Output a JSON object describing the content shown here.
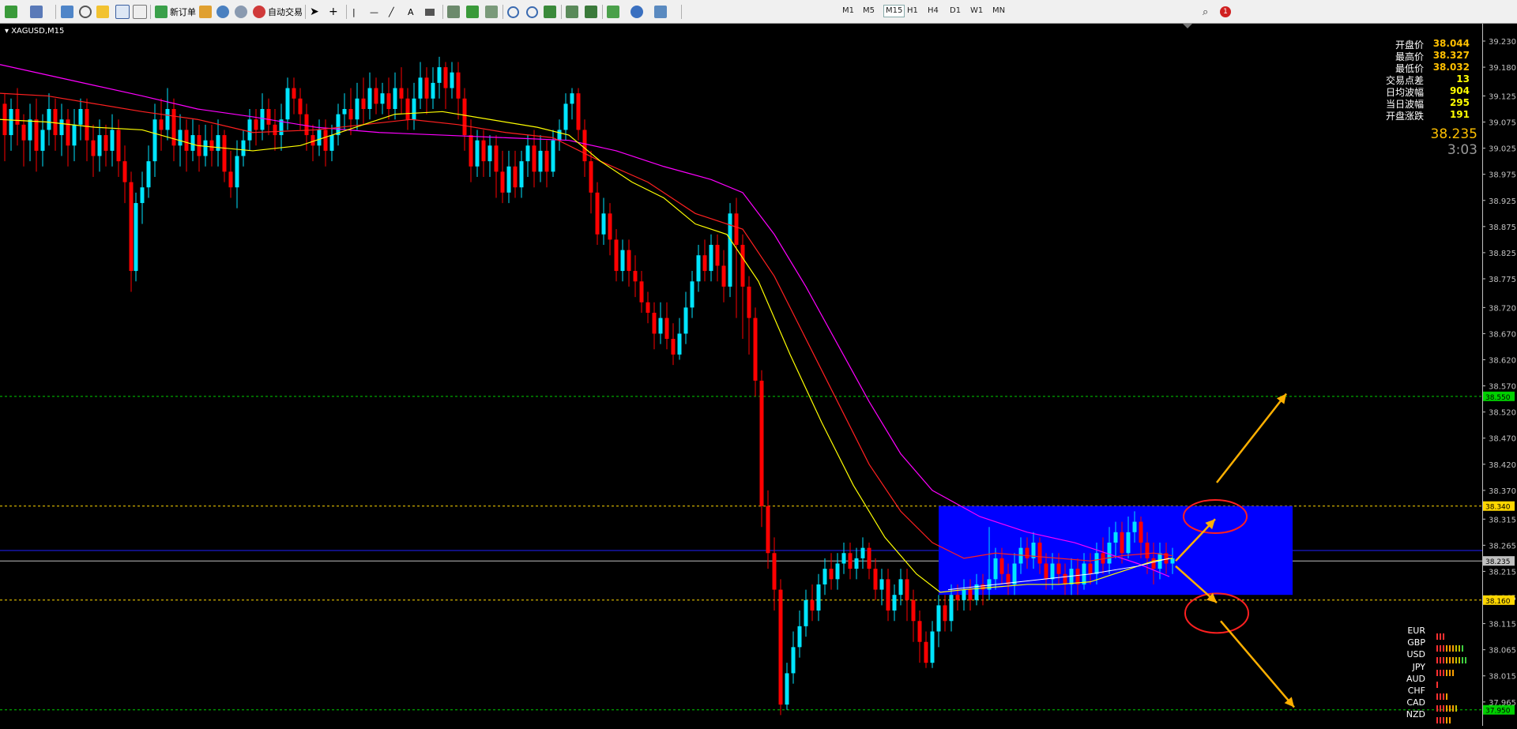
{
  "toolbar": {
    "new_order": "新订单",
    "auto_trade": "自动交易",
    "text_tool": "A",
    "timeframes": [
      "M1",
      "M5",
      "M15",
      "H1",
      "H4",
      "D1",
      "W1",
      "MN"
    ],
    "active_timeframe": "M15"
  },
  "symbol": "XAGUSD,M15",
  "info": [
    {
      "label": "开盘价",
      "value": "38.044",
      "color": "#ffc000"
    },
    {
      "label": "最高价",
      "value": "38.327",
      "color": "#ffc000"
    },
    {
      "label": "最低价",
      "value": "38.032",
      "color": "#ffc000"
    },
    {
      "label": "交易点差",
      "value": "13",
      "color": "#ffff00"
    },
    {
      "label": "日均波幅",
      "value": "904",
      "color": "#ffff00"
    },
    {
      "label": "当日波幅",
      "value": "295",
      "color": "#ffff00"
    },
    {
      "label": "开盘涨跌",
      "value": "191",
      "color": "#ffff00"
    }
  ],
  "bid_price": "38.235",
  "countdown": "3:03",
  "price_scale": [
    "39.230",
    "39.180",
    "39.125",
    "39.075",
    "39.025",
    "38.975",
    "38.925",
    "38.875",
    "38.825",
    "38.775",
    "38.720",
    "38.670",
    "38.620",
    "38.570",
    "38.520",
    "38.470",
    "38.420",
    "38.370",
    "38.315",
    "38.265",
    "38.215",
    "38.165",
    "38.115",
    "38.065",
    "38.015",
    "37.965"
  ],
  "price_tags": [
    {
      "price": "38.550",
      "color": "#00d000"
    },
    {
      "price": "38.340",
      "color": "#ffd700"
    },
    {
      "price": "38.235",
      "color": "#c0c0c0"
    },
    {
      "price": "38.160",
      "color": "#ffd700"
    },
    {
      "price": "37.950",
      "color": "#00d000"
    }
  ],
  "currencies": [
    {
      "code": "EUR",
      "strength": 3
    },
    {
      "code": "GBP",
      "strength": 9
    },
    {
      "code": "USD",
      "strength": 10
    },
    {
      "code": "JPY",
      "strength": 6
    },
    {
      "code": "AUD",
      "strength": 1
    },
    {
      "code": "CHF",
      "strength": 4
    },
    {
      "code": "CAD",
      "strength": 7
    },
    {
      "code": "NZD",
      "strength": 5
    }
  ],
  "colors": {
    "bull": "#00e5ff",
    "bear": "#ff0000",
    "ma_fast": "#ffff00",
    "ma_mid": "#ff2020",
    "ma_slow": "#ff00ff",
    "box": "#0000ff",
    "arrow": "#ffb000",
    "circle": "#ff2020",
    "green_level": "#00d000",
    "yellow_level": "#ffd700"
  }
}
